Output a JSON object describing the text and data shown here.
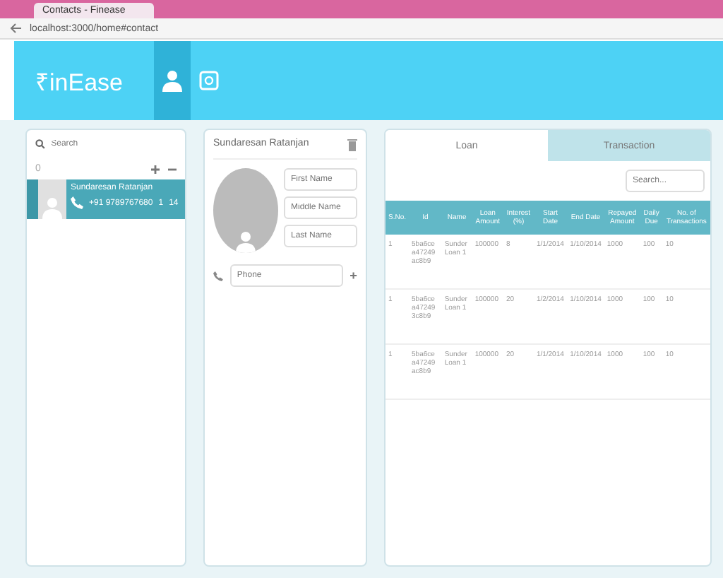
{
  "browser": {
    "tab_title": "Contacts - Finease",
    "url": "localhost:3000/home#contact"
  },
  "app": {
    "logo": "₹inEase",
    "nav": [
      {
        "selected": true
      },
      {
        "selected": false
      }
    ]
  },
  "contacts": {
    "search_placeholder": "Search",
    "filter_label": "0",
    "items": [
      {
        "name": "Sundaresan Ratanjan",
        "phone": "+91 9789767680",
        "loans": "1",
        "transactions": "14",
        "selected": true
      }
    ]
  },
  "detail": {
    "name": "Sundaresan Ratanjan",
    "fields": [
      {
        "placeholder": "First Name"
      },
      {
        "placeholder": "Middle Name"
      },
      {
        "placeholder": "Last Name"
      }
    ],
    "phone_placeholder": "Phone"
  },
  "tabs": [
    {
      "label": "Loan",
      "selected": true
    },
    {
      "label": "Transaction",
      "selected": false
    }
  ],
  "table_search_placeholder": "Search...",
  "table": {
    "columns": [
      "S.No.",
      "Id",
      "Name",
      "Loan Amount",
      "Interest (%)",
      "Start Date",
      "End Date",
      "Repayed Amount",
      "Daily Due",
      "No. of Transactions"
    ],
    "rows": [
      [
        "1",
        "5ba6ce a47249 ac8b9",
        "Sunder Loan 1",
        "100000",
        "8",
        "1/1/2014",
        "1/10/2014",
        "1000",
        "100",
        "10"
      ],
      [
        "1",
        "5ba6ce a47249 3c8b9",
        "Sunder Loan 1",
        "100000",
        "20",
        "1/2/2014",
        "1/10/2014",
        "1000",
        "100",
        "10"
      ],
      [
        "1",
        "5ba6ce a47249 ac8b9",
        "Sunder Loan 1",
        "100000",
        "20",
        "1/1/2014",
        "1/10/2014",
        "1000",
        "100",
        "10"
      ]
    ]
  }
}
